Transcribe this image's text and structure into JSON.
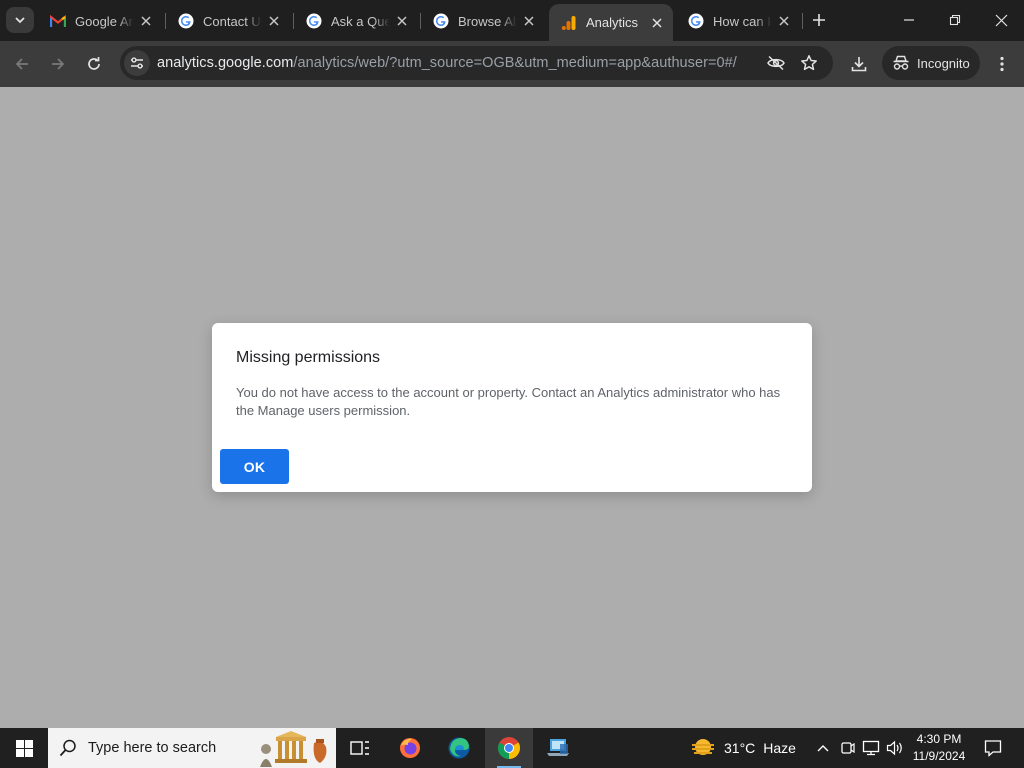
{
  "browser": {
    "tabs": [
      {
        "title": "Google An",
        "icon": "gmail-icon",
        "active": false
      },
      {
        "title": "Contact Us",
        "icon": "google-icon",
        "active": false
      },
      {
        "title": "Ask a Question",
        "icon": "google-icon",
        "active": false
      },
      {
        "title": "Browse All",
        "icon": "google-icon",
        "active": false
      },
      {
        "title": "Analytics",
        "icon": "analytics-icon",
        "active": true
      },
      {
        "title": "How can I",
        "icon": "google-icon",
        "active": false
      }
    ],
    "url_host": "analytics.google.com",
    "url_path": "/analytics/web/?utm_source=OGB&utm_medium=app&authuser=0#/",
    "incognito_label": "Incognito"
  },
  "dialog": {
    "title": "Missing permissions",
    "body": "You do not have access to the account or property. Contact an Analytics administrator who has the Manage users permission.",
    "ok_label": "OK"
  },
  "taskbar": {
    "search_placeholder": "Type here to search",
    "weather_temp": "31°C",
    "weather_desc": "Haze",
    "time": "4:30 PM",
    "date": "11/9/2024"
  },
  "colors": {
    "accent": "#1a73e8",
    "overlay": "#adadad",
    "chrome_dark": "#1f1f1f",
    "toolbar": "#3c3c3c"
  }
}
